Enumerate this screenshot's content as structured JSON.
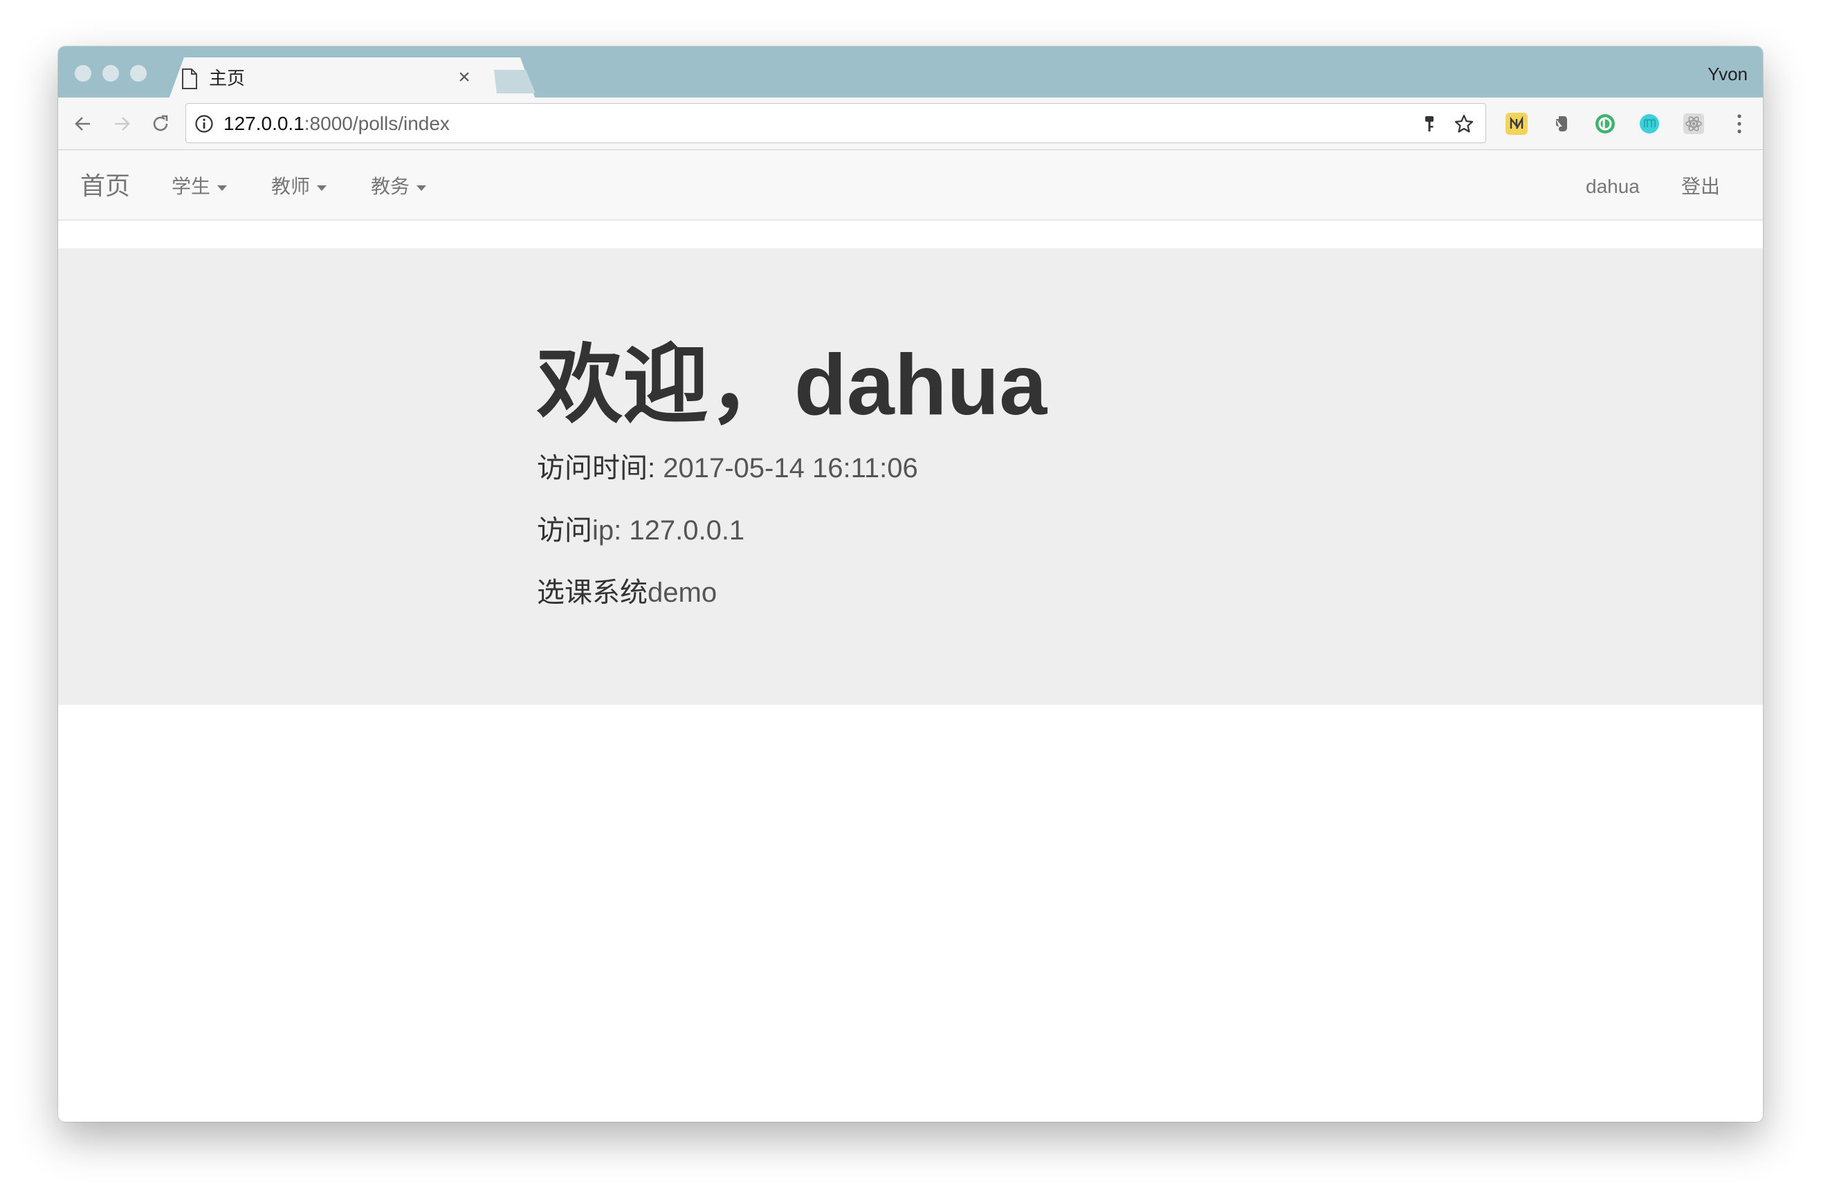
{
  "browser": {
    "tab_title": "主页",
    "tab_close": "×",
    "profile_name": "Yvon",
    "url_host": "127.0.0.1",
    "url_rest": ":8000/polls/index",
    "accent_titlebar": "#9dbfca",
    "extensions": [
      "notion-style-icon",
      "evernote-icon",
      "grammarly-icon",
      "mercury-icon",
      "react-devtools-icon"
    ]
  },
  "navbar": {
    "brand": "首页",
    "items": [
      {
        "label": "学生"
      },
      {
        "label": "教师"
      },
      {
        "label": "教务"
      }
    ],
    "user": "dahua",
    "logout": "登出"
  },
  "jumbotron": {
    "welcome_prefix": "欢迎，",
    "welcome_name": "dahua",
    "visit_time_label": "访问时间:",
    "visit_time_value": " 2017-05-14 16:11:06",
    "visit_ip_label": "访问",
    "visit_ip_value": "ip: 127.0.0.1",
    "system_label": "选课系统",
    "system_value": "demo"
  }
}
